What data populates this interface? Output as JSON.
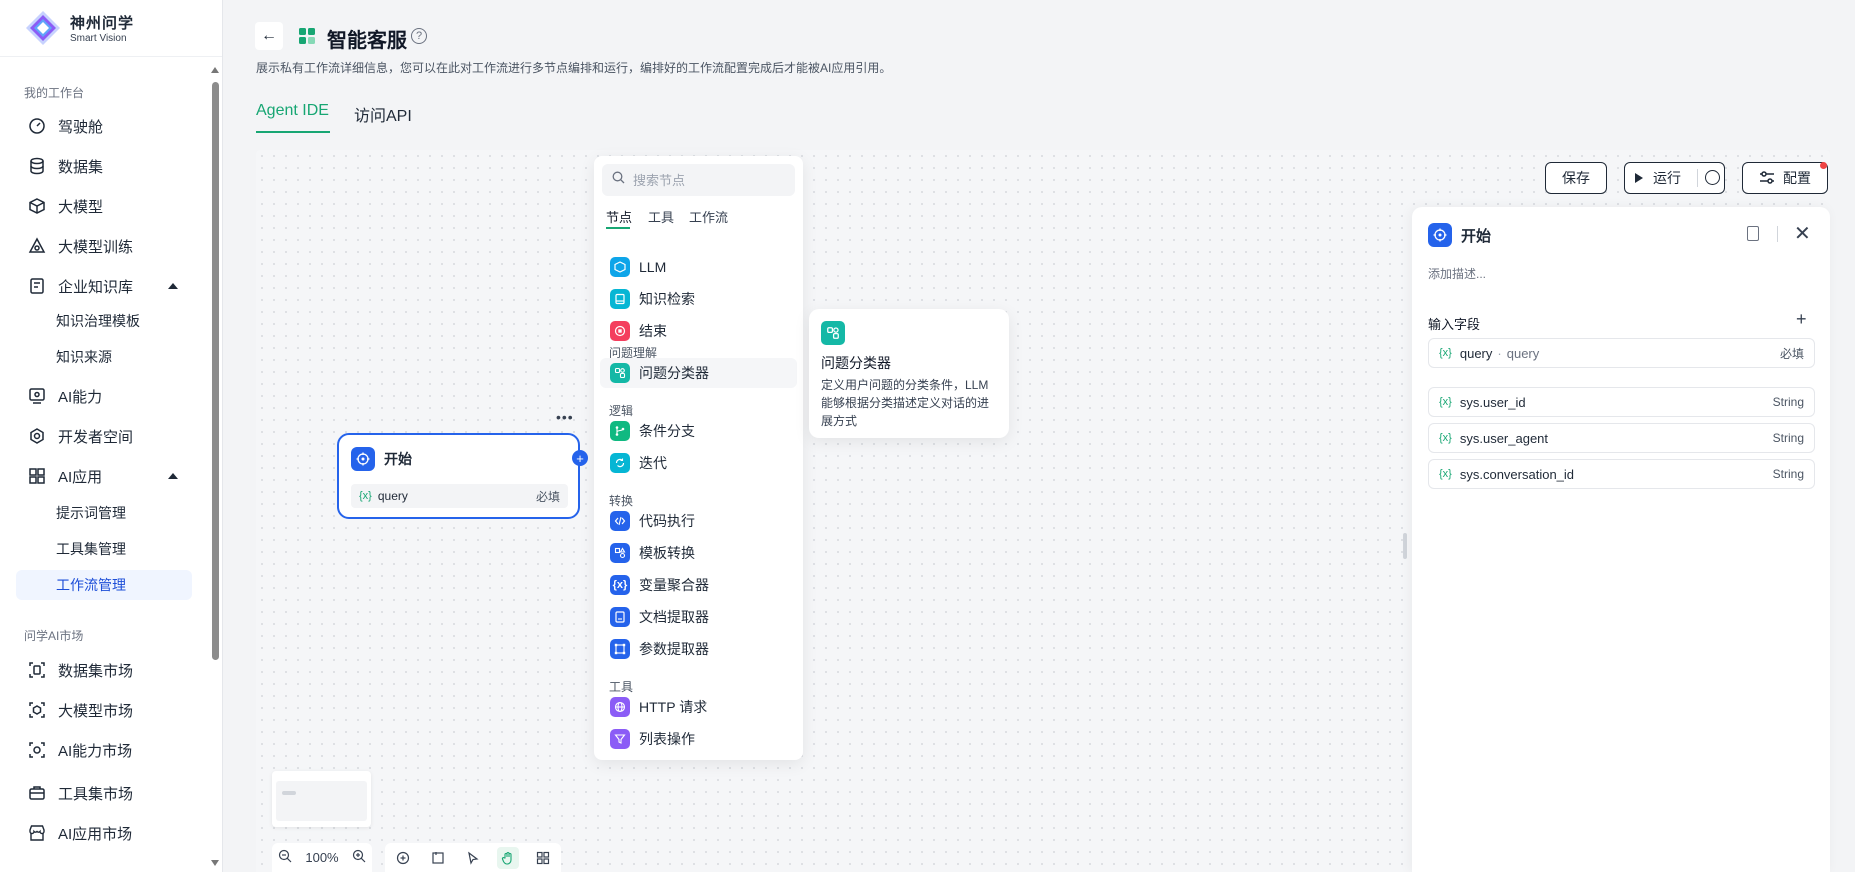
{
  "brand": {
    "title": "神州问学",
    "subtitle": "Smart Vision"
  },
  "sidebar": {
    "groups": [
      {
        "label": "我的工作台"
      },
      {
        "label": "问学AI市场"
      }
    ],
    "items": [
      {
        "label": "驾驶舱",
        "icon": "dashboard-icon"
      },
      {
        "label": "数据集",
        "icon": "database-icon"
      },
      {
        "label": "大模型",
        "icon": "cube-icon"
      },
      {
        "label": "大模型训练",
        "icon": "training-icon"
      },
      {
        "label": "企业知识库",
        "icon": "knowledge-icon"
      },
      {
        "label": "AI能力",
        "icon": "ai-ability-icon"
      },
      {
        "label": "开发者空间",
        "icon": "developer-icon"
      },
      {
        "label": "AI应用",
        "icon": "apps-grid-icon"
      },
      {
        "label": "数据集市场",
        "icon": "dataset-market-icon"
      },
      {
        "label": "大模型市场",
        "icon": "model-market-icon"
      },
      {
        "label": "AI能力市场",
        "icon": "ai-market-icon"
      },
      {
        "label": "工具集市场",
        "icon": "toolbox-market-icon"
      },
      {
        "label": "AI应用市场",
        "icon": "store-icon"
      }
    ],
    "subitems": [
      {
        "label": "知识治理模板"
      },
      {
        "label": "知识来源"
      },
      {
        "label": "提示词管理"
      },
      {
        "label": "工具集管理"
      },
      {
        "label": "工作流管理"
      }
    ]
  },
  "header": {
    "title": "智能客服",
    "description": "展示私有工作流详细信息，您可以在此对工作流进行多节点编排和运行，编排好的工作流配置完成后才能被AI应用引用。",
    "tabs": [
      {
        "label": "Agent IDE"
      },
      {
        "label": "访问API"
      }
    ]
  },
  "toolbar": {
    "save": "保存",
    "run": "运行",
    "config": "配置"
  },
  "picker": {
    "search_placeholder": "搜索节点",
    "tabs": [
      "节点",
      "工具",
      "工作流"
    ],
    "groups": [
      "问题理解",
      "逻辑",
      "转换",
      "工具"
    ],
    "items": [
      {
        "label": "LLM",
        "color": "#0ea5e9"
      },
      {
        "label": "知识检索",
        "color": "#06b6d4"
      },
      {
        "label": "结束",
        "color": "#f43f5e"
      },
      {
        "label": "问题分类器",
        "color": "#14b8a6"
      },
      {
        "label": "条件分支",
        "color": "#10b981"
      },
      {
        "label": "迭代",
        "color": "#06b6d4"
      },
      {
        "label": "代码执行",
        "color": "#2563eb"
      },
      {
        "label": "模板转换",
        "color": "#2563eb"
      },
      {
        "label": "变量聚合器",
        "color": "#2563eb"
      },
      {
        "label": "文档提取器",
        "color": "#2563eb"
      },
      {
        "label": "参数提取器",
        "color": "#2563eb"
      },
      {
        "label": "HTTP 请求",
        "color": "#8b5cf6"
      },
      {
        "label": "列表操作",
        "color": "#8b5cf6"
      }
    ]
  },
  "tooltip": {
    "title": "问题分类器",
    "description": "定义用户问题的分类条件，LLM 能够根据分类描述定义对话的进展方式"
  },
  "start_node": {
    "title": "开始",
    "var_icon": "{x}",
    "var": "query",
    "required": "必填"
  },
  "panel": {
    "title": "开始",
    "description_placeholder": "添加描述...",
    "section": "输入字段",
    "input_field": {
      "icon": "{x}",
      "name": "query",
      "label": "query",
      "required": "必填"
    },
    "sys_fields": [
      {
        "name": "sys.user_id",
        "type": "String"
      },
      {
        "name": "sys.user_agent",
        "type": "String"
      },
      {
        "name": "sys.conversation_id",
        "type": "String"
      }
    ]
  },
  "zoom": {
    "level": "100%"
  }
}
